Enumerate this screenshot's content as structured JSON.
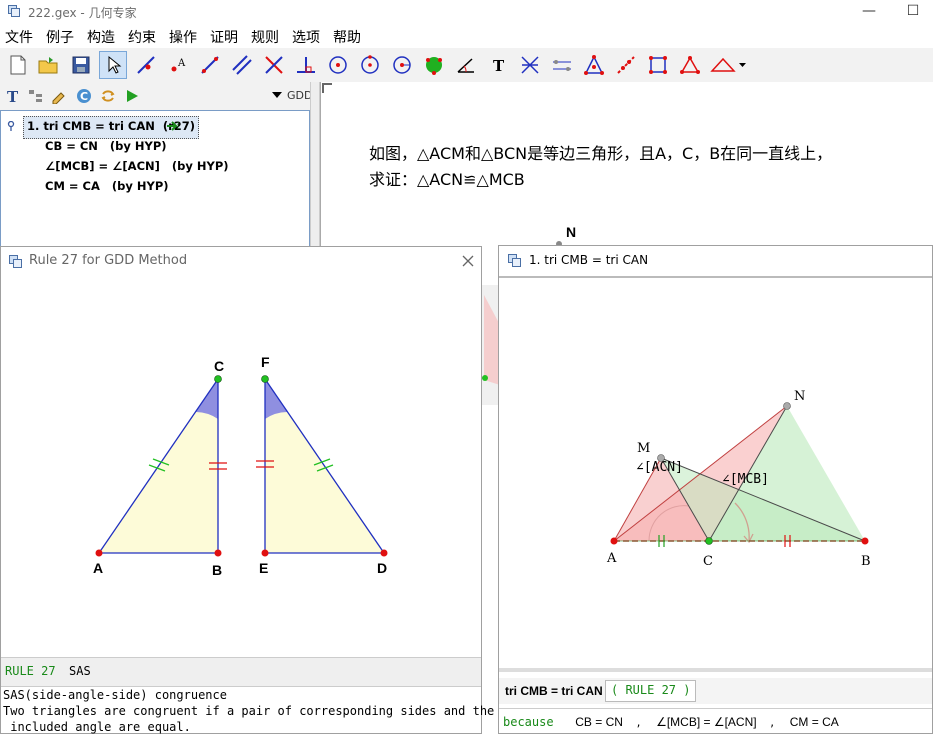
{
  "app": {
    "title": "222.gex - 几何专家",
    "minimize": "—",
    "maximize": "☐"
  },
  "menu": [
    "文件",
    "例子",
    "构造",
    "约束",
    "操作",
    "证明",
    "规则",
    "选项",
    "帮助"
  ],
  "left_toolbar": {
    "mode_label": "GDD"
  },
  "tree": {
    "root": "1. tri CMB = tri CAN  (r27)",
    "items": [
      "CB = CN   (by HYP)",
      "∠[MCB] = ∠[ACN]   (by HYP)",
      "CM = CA   (by HYP)"
    ]
  },
  "problem": {
    "line1": "如图，△ACM和△BCN是等边三角形，且A，C，B在同一直线上，",
    "line2": "求证：△ACN≌△MCB"
  },
  "rule_window": {
    "title": "Rule 27 for GDD Method",
    "points": {
      "A": "A",
      "B": "B",
      "C": "C",
      "D": "D",
      "E": "E",
      "F": "F"
    },
    "rule_label": "RULE 27",
    "rule_name": "SAS",
    "desc1": "SAS(side-angle-side) congruence",
    "desc2": "Two triangles are congruent if a pair of corresponding sides and the",
    "desc3": " included angle are equal."
  },
  "proof_window": {
    "title": "1. tri CMB = tri CAN",
    "points": {
      "A": "A",
      "B": "B",
      "C": "C",
      "M": "M",
      "N": "N"
    },
    "angle1": "∠[ACN]",
    "angle2": "∠[MCB]",
    "status_fact": "tri CMB = tri CAN",
    "status_rule": "( RULE 27 )",
    "because": "because",
    "reason1": "CB = CN",
    "reason2": "∠[MCB] = ∠[ACN]",
    "reason3": "CM = CA",
    "sep": ","
  },
  "main_canvas": {
    "point_N": "N"
  },
  "colors": {
    "accent_green": "#1a8a1a",
    "point_red": "#e01010",
    "point_green": "#22c022",
    "line_blue": "#2030c0",
    "fill_yellow": "#fdfbd8",
    "tick_red": "#e01010",
    "tick_green": "#22c022"
  }
}
